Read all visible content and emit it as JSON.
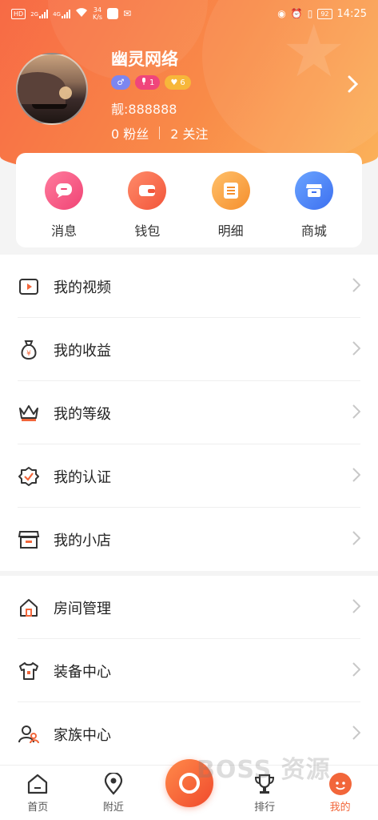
{
  "status_bar": {
    "hd": "HD",
    "sig1": "2G",
    "sig2": "4G",
    "speed_value": "34",
    "speed_unit": "K/s",
    "battery": "92",
    "time": "14:25"
  },
  "profile": {
    "username": "幽灵网络",
    "badges": [
      {
        "icon": "male-gender-icon",
        "value": "♂",
        "color": "#7c86f0"
      },
      {
        "icon": "microphone-icon",
        "value": "1",
        "color": "#f0457b"
      },
      {
        "icon": "heart-icon",
        "value": "6",
        "color": "#f7b73a"
      }
    ],
    "beauty_id": "靓:888888",
    "fans": "0 粉丝",
    "following": "2 关注"
  },
  "quick_actions": [
    {
      "label": "消息",
      "icon": "message-icon"
    },
    {
      "label": "钱包",
      "icon": "wallet-icon"
    },
    {
      "label": "明细",
      "icon": "detail-list-icon"
    },
    {
      "label": "商城",
      "icon": "mall-icon"
    }
  ],
  "menu_group1": [
    {
      "label": "我的视频",
      "icon": "video-icon"
    },
    {
      "label": "我的收益",
      "icon": "money-bag-icon"
    },
    {
      "label": "我的等级",
      "icon": "crown-icon"
    },
    {
      "label": "我的认证",
      "icon": "certification-icon"
    },
    {
      "label": "我的小店",
      "icon": "shop-icon"
    }
  ],
  "menu_group2": [
    {
      "label": "房间管理",
      "icon": "room-icon"
    },
    {
      "label": "装备中心",
      "icon": "tshirt-icon"
    },
    {
      "label": "家族中心",
      "icon": "family-icon"
    }
  ],
  "tabbar": [
    {
      "label": "首页",
      "icon": "home-icon"
    },
    {
      "label": "附近",
      "icon": "location-icon"
    },
    {
      "label": "",
      "icon": "live-center-icon"
    },
    {
      "label": "排行",
      "icon": "trophy-icon"
    },
    {
      "label": "我的",
      "icon": "mine-icon"
    }
  ],
  "watermark": "BOSS 资源",
  "colors": {
    "accent": "#f2663a",
    "header_start": "#f76a45",
    "header_end": "#fbb25a"
  }
}
